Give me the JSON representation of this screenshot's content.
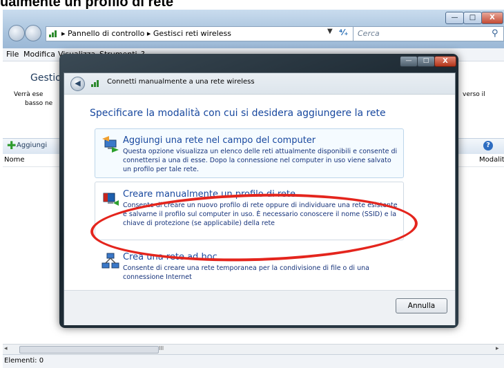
{
  "caption": "ualmente un profilo di rete",
  "explorer": {
    "breadcrumb": "▸ Pannello di controllo ▸ Gestisci reti wireless",
    "search_placeholder": "Cerca",
    "menu": [
      "File",
      "Modifica",
      "Visualizza",
      "Strumenti",
      "?"
    ],
    "title_partial": "Gestio",
    "desc_line1": "Verrà ese",
    "desc_line2": "basso ne",
    "desc_right": "verso il",
    "add_label": "Aggiungi",
    "col_name": "Nome",
    "col_mode": "Modalit",
    "scroll_grip": "III",
    "status": "Elementi: 0"
  },
  "dialog": {
    "title": "Connetti manualmente a una rete wireless",
    "instruction": "Specificare la modalità con cui si desidera aggiungere la rete",
    "options": [
      {
        "title": "Aggiungi una rete nel campo del computer",
        "description": "Questa opzione visualizza un elenco delle reti attualmente disponibili e consente di connettersi a una di esse. Dopo la connessione nel computer in uso viene salvato un profilo per tale rete.",
        "icon": "network-add-icon"
      },
      {
        "title": "Creare manualmente un profilo di rete",
        "description": "Consente di creare un nuovo profilo di rete oppure di individuare una rete esistente e salvarne il profilo sul computer in uso. È necessario conoscere il nome (SSID) e la chiave di protezione (se applicabile) della rete",
        "icon": "network-profile-icon"
      },
      {
        "title": "Crea una rete ad hoc",
        "description": "Consente di creare una rete temporanea per la condivisione di file o di una connessione Internet",
        "icon": "adhoc-network-icon"
      }
    ],
    "cancel_label": "Annulla"
  },
  "highlight_color": "#e4251d"
}
